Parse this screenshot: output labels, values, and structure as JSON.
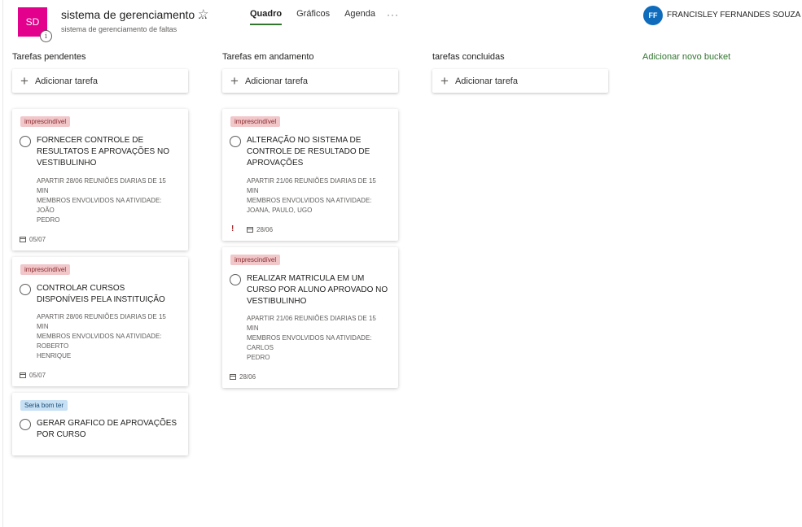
{
  "header": {
    "plan_initials": "SD",
    "info_glyph": "i",
    "plan_title": "sistema de gerenciamento ...",
    "plan_subtitle": "sistema de gerenciamento de faltas",
    "tabs": [
      {
        "label": "Quadro",
        "active": true
      },
      {
        "label": "Gráficos",
        "active": false
      },
      {
        "label": "Agenda",
        "active": false
      }
    ],
    "more_glyph": "···",
    "user_initials": "FF",
    "user_name": "FRANCISLEY FERNANDES SOUZA",
    "accent_color": "#31752f",
    "plan_color": "#e3008c",
    "avatar_color": "#0f6cbd"
  },
  "buckets": [
    {
      "title": "Tarefas pendentes",
      "add_label": "Adicionar tarefa",
      "cards": [
        {
          "label": "imprescindível",
          "title": "FORNECER CONTROLE DE RESULTATOS E APROVAÇÕES NO VESTIBULINHO",
          "desc": [
            "APARTIR 28/06 REUNIÕES DIARIAS DE 15 MIN",
            "MEMBROS ENVOLVIDOS NA ATIVIDADE:",
            "JOÃO",
            "PEDRO"
          ],
          "date": "05/07"
        },
        {
          "label": "imprescindível",
          "title": "CONTROLAR CURSOS DISPONÍVEIS PELA INSTITUIÇÃO",
          "desc": [
            "APARTIR 28/06 REUNIÕES DIARIAS DE 15 MIN",
            "MEMBROS ENVOLVIDOS NA ATIVIDADE:",
            "ROBERTO",
            "HENRIQUE"
          ],
          "date": "05/07"
        },
        {
          "label": "Seria bom ter",
          "title": "GERAR GRAFICO DE APROVAÇÕES POR CURSO"
        }
      ]
    },
    {
      "title": "Tarefas em andamento",
      "add_label": "Adicionar tarefa",
      "cards": [
        {
          "label": "imprescindível",
          "title": "ALTERAÇÃO NO SISTEMA DE CONTROLE DE RESULTADO DE APROVAÇÕES",
          "desc": [
            "APARTIR 21/06 REUNIÕES DIARIAS DE 15 MIN",
            "MEMBROS ENVOLVIDOS NA ATIVIDADE:",
            "JOANA, PAULO, UGO"
          ],
          "priority_glyph": "!",
          "date": "28/06"
        },
        {
          "label": "imprescindível",
          "title": "REALIZAR MATRICULA EM UM CURSO POR ALUNO APROVADO NO VESTIBULINHO",
          "desc": [
            "APARTIR 21/06 REUNIÕES DIARIAS DE 15 MIN",
            "MEMBROS ENVOLVIDOS NA ATIVIDADE:",
            "CARLOS",
            "PEDRO"
          ],
          "date": "28/06"
        }
      ]
    },
    {
      "title": "tarefas concluidas",
      "add_label": "Adicionar tarefa",
      "cards": []
    }
  ],
  "add_bucket_label": "Adicionar novo bucket"
}
